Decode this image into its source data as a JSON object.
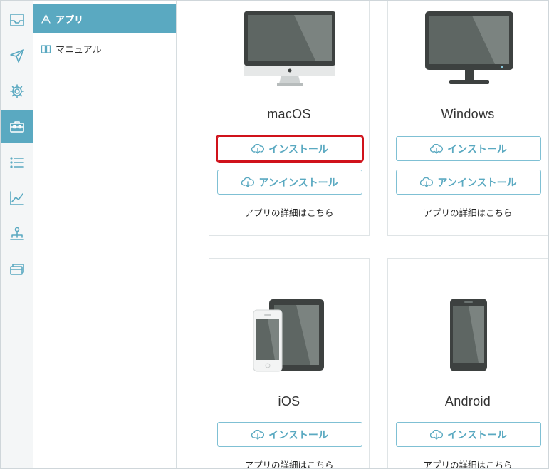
{
  "sidebar": {
    "items": [
      {
        "icon": "inbox-icon"
      },
      {
        "icon": "paper-plane-icon"
      },
      {
        "icon": "gear-icon"
      },
      {
        "icon": "toolbox-icon",
        "active": true
      },
      {
        "icon": "list-icon"
      },
      {
        "icon": "line-chart-icon"
      },
      {
        "icon": "person-tree-icon"
      },
      {
        "icon": "cards-icon"
      }
    ]
  },
  "subnav": {
    "items": [
      {
        "label": "アプリ",
        "icon": "app-icon",
        "active": true
      },
      {
        "label": "マニュアル",
        "icon": "book-icon",
        "active": false
      }
    ]
  },
  "apps": [
    {
      "name": "macOS",
      "install_label": "インストール",
      "uninstall_label": "アンインストール",
      "details_label": "アプリの詳細はこちら"
    },
    {
      "name": "Windows",
      "install_label": "インストール",
      "uninstall_label": "アンインストール",
      "details_label": "アプリの詳細はこちら"
    },
    {
      "name": "iOS",
      "install_label": "インストール",
      "details_label": "アプリの詳細はこちら"
    },
    {
      "name": "Android",
      "install_label": "インストール",
      "details_label": "アプリの詳細はこちら"
    }
  ],
  "colors": {
    "accent": "#5aa9c1",
    "highlight": "#d0121b",
    "rail_bg": "#f4f6f7",
    "device_dark": "#3d4140",
    "device_screen": "#5e6663"
  }
}
